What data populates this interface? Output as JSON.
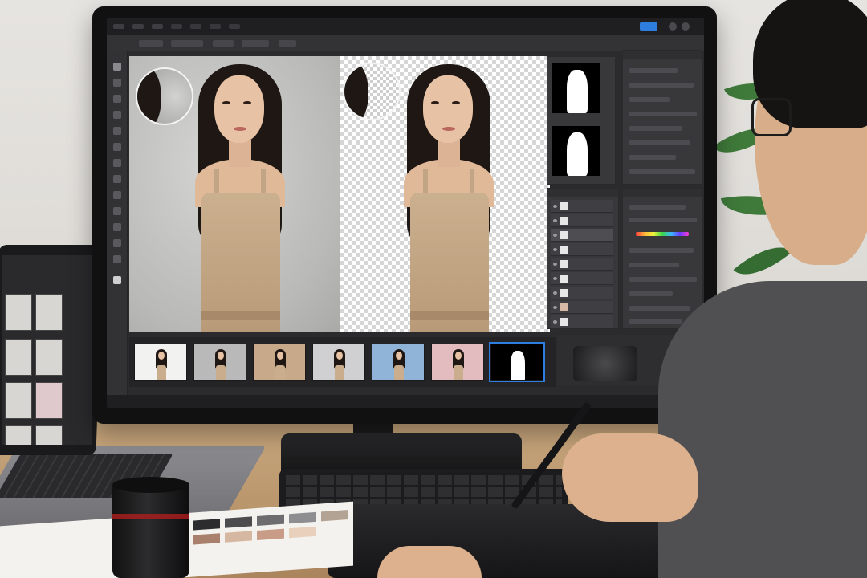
{
  "scene": {
    "description_colors": {
      "accent": "#2e7ee0",
      "app_dark": "#2b2b2d",
      "desk": "#c9a87f",
      "dress": "#cbb08f"
    }
  },
  "editor": {
    "menu_items": [
      "",
      "",
      "",
      "",
      "",
      "",
      "",
      "",
      ""
    ],
    "canvases": [
      {
        "id": "original",
        "background": "gray-textured"
      },
      {
        "id": "cutout",
        "background": "transparency-checker"
      }
    ],
    "filmstrip_backgrounds": [
      "#f2f2f0",
      "#b9b9b9",
      "#c8a98a",
      "#d0d0d2",
      "#8fb4d8",
      "#e3bcc0",
      "#000000"
    ],
    "filmstrip_selected": 6,
    "mask_thumbnails": 2,
    "layer_count": 9
  },
  "laptop": {
    "thumbnail_count": 8
  },
  "swatch_card": {
    "colors": [
      "#2c2c2e",
      "#4c4c4f",
      "#6d6d70",
      "#8e8e91",
      "#b3a394",
      "#a9806c",
      "#d6b8a2",
      "#c89c86",
      "#e8d0bd"
    ]
  },
  "icons": [
    "menu-icon",
    "move-tool-icon",
    "lasso-tool-icon",
    "brush-tool-icon",
    "eye-icon",
    "share-icon"
  ]
}
